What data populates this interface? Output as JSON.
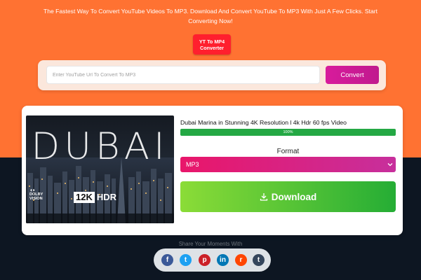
{
  "header": {
    "tagline": "The Fastest Way To Convert YouTube Videos To MP3. Download And Convert YouTube To MP3 With Just A Few Clicks. Start Converting Now!",
    "mp4_button_line1": "YT To MP4",
    "mp4_button_line2": "Converter"
  },
  "search": {
    "placeholder": "Enter YouTube Url To Convert To MP3",
    "value": "",
    "convert_label": "Convert"
  },
  "result": {
    "thumbnail": {
      "overlay_text": "DUBAI",
      "dolby_line1": "DOLBY",
      "dolby_line2": "VISION",
      "resolution_badge": "12K",
      "hdr_badge": "HDR"
    },
    "video_title": "Dubai Marina in Stunning 4K Resolution l 4k Hdr 60 fps Video",
    "progress": {
      "value": 100,
      "label": "100%"
    },
    "format_label": "Format",
    "format_selected": "MP3",
    "download_label": "Download"
  },
  "share": {
    "label": "Share Your Moments With",
    "icons": [
      {
        "name": "facebook-icon",
        "glyph": "f",
        "color": "#3b5998"
      },
      {
        "name": "twitter-icon",
        "glyph": "t",
        "color": "#1da1f2"
      },
      {
        "name": "pinterest-icon",
        "glyph": "p",
        "color": "#cb2027"
      },
      {
        "name": "linkedin-icon",
        "glyph": "in",
        "color": "#0077b5"
      },
      {
        "name": "reddit-icon",
        "glyph": "r",
        "color": "#ff4500"
      },
      {
        "name": "tumblr-icon",
        "glyph": "t",
        "color": "#35465c"
      }
    ]
  },
  "colors": {
    "top_background": "#ff7232",
    "bottom_background": "#0d1622",
    "convert_button": "#d81b9c",
    "progress_fill": "#24a844",
    "download_start": "#8bdc37",
    "download_end": "#25ad35"
  }
}
